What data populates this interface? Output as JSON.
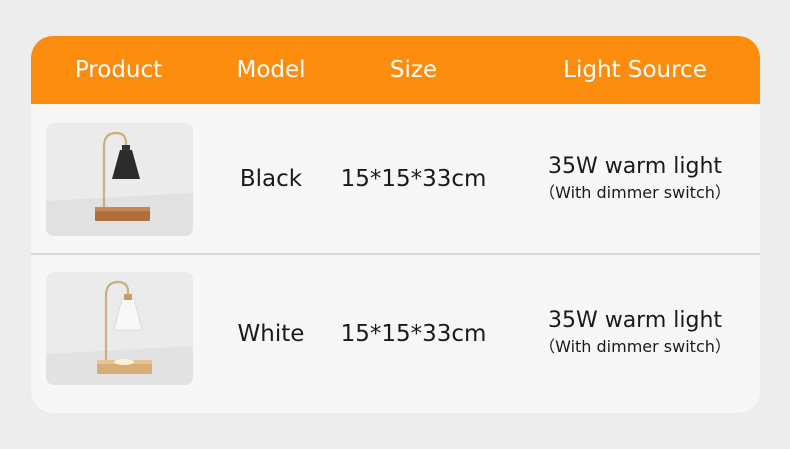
{
  "header": {
    "product": "Product",
    "model": "Model",
    "size": "Size",
    "light_source": "Light Source"
  },
  "rows": [
    {
      "product_image": "black-lamp-warmer-image",
      "model": "Black",
      "size": "15*15*33cm",
      "light_main": "35W warm light",
      "light_sub": "（With dimmer switch）"
    },
    {
      "product_image": "white-lamp-warmer-image",
      "model": "White",
      "size": "15*15*33cm",
      "light_main": "35W warm light",
      "light_sub": "（With dimmer switch）"
    }
  ],
  "colors": {
    "header_bg": "#fb8c0e",
    "card_bg": "#f7f7f7",
    "page_bg": "#ededed"
  }
}
